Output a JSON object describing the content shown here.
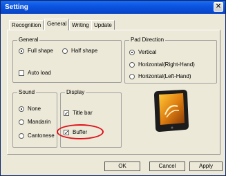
{
  "window": {
    "title": "Setting",
    "close_icon": "close-icon"
  },
  "tabs": [
    "Recognition",
    "General",
    "Writing",
    "Update"
  ],
  "general": {
    "title": "General",
    "full_shape": "Full shape",
    "half_shape": "Half shape",
    "auto_load": "Auto load"
  },
  "pad_direction": {
    "title": "Pad Direction",
    "vertical": "Vertical",
    "horizontal_right": "Horizontal(Right-Hand)",
    "horizontal_left": "Horizontal(Left-Hand)"
  },
  "sound": {
    "title": "Sound",
    "none": "None",
    "mandarin": "Mandarin",
    "cantonese": "Cantonese"
  },
  "display": {
    "title": "Display",
    "title_bar": "Title bar",
    "buffer": "Buffer"
  },
  "buttons": {
    "ok": "OK",
    "cancel": "Cancel",
    "apply": "Apply"
  },
  "colors": {
    "title_bar": "#0a53e0",
    "highlight": "#e0101a",
    "dialog_bg": "#ece9d8"
  }
}
